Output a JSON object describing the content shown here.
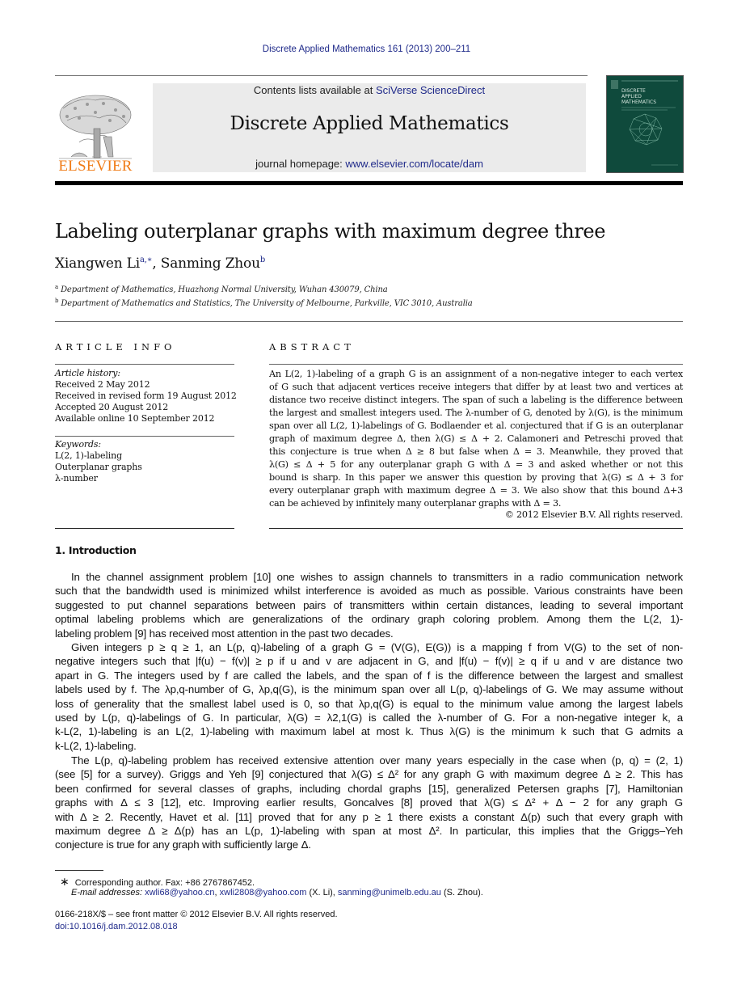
{
  "header": {
    "journal_ref": "Discrete Applied Mathematics 161 (2013) 200–211",
    "contents_prefix": "Contents lists available at ",
    "contents_link": "SciVerse ScienceDirect",
    "journal_title": "Discrete Applied Mathematics",
    "homepage_prefix": "journal homepage: ",
    "homepage_link": "www.elsevier.com/locate/dam",
    "publisher_logo_text": "ELSEVIER",
    "cover_title_lines": [
      "DISCRETE",
      "APPLIED",
      "MATHEMATICS"
    ],
    "colors": {
      "link": "#1f2a8a",
      "elsevier_orange": "#f07b16",
      "cover_green": "#0f4a3c",
      "banner_gray": "#ebebeb"
    }
  },
  "article": {
    "title": "Labeling outerplanar graphs with maximum degree three",
    "authors": [
      {
        "name": "Xiangwen Li",
        "marks": "a,∗"
      },
      {
        "name": "Sanming Zhou",
        "marks": "b"
      }
    ],
    "author_separator": ", ",
    "affiliations": [
      {
        "mark": "a",
        "text": "Department of Mathematics, Huazhong Normal University, Wuhan 430079, China"
      },
      {
        "mark": "b",
        "text": "Department of Mathematics and Statistics, The University of Melbourne, Parkville, VIC 3010, Australia"
      }
    ]
  },
  "article_info": {
    "heading": "ARTICLE INFO",
    "history_label": "Article history:",
    "history": [
      "Received 2 May 2012",
      "Received in revised form 19 August 2012",
      "Accepted 20 August 2012",
      "Available online 10 September 2012"
    ],
    "keywords_label": "Keywords:",
    "keywords": [
      "L(2, 1)-labeling",
      "Outerplanar graphs",
      "λ-number"
    ]
  },
  "abstract": {
    "heading": "ABSTRACT",
    "lines": [
      "An L(2, 1)-labeling of a graph G is an assignment of a non-negative integer to each vertex",
      "of G such that adjacent vertices receive integers that differ by at least two and vertices at",
      "distance two receive distinct integers. The span of such a labeling is the difference between",
      "the largest and smallest integers used. The λ-number of G, denoted by λ(G), is the minimum",
      "span over all L(2, 1)-labelings of G. Bodlaender et al. conjectured that if G is an outerplanar",
      "graph of maximum degree Δ, then λ(G) ≤ Δ + 2. Calamoneri and Petreschi proved that",
      "this conjecture is true when Δ ≥ 8 but false when Δ = 3. Meanwhile, they proved that",
      "λ(G) ≤ Δ + 5 for any outerplanar graph G with Δ = 3 and asked whether or not this",
      "bound is sharp. In this paper we answer this question by proving that λ(G) ≤ Δ + 3 for",
      "every outerplanar graph with maximum degree Δ = 3. We also show that this bound Δ+3",
      "can be achieved by infinitely many outerplanar graphs with Δ = 3."
    ],
    "copyright": "© 2012 Elsevier B.V. All rights reserved."
  },
  "introduction": {
    "heading": "1.  Introduction",
    "paragraphs": [
      [
        "In the channel assignment problem [10] one wishes to assign channels to transmitters in a radio communication network",
        "such that the bandwidth used is minimized whilst interference is avoided as much as possible. Various constraints have been",
        "suggested to put channel separations between pairs of transmitters within certain distances, leading to several important",
        "optimal labeling problems which are generalizations of the ordinary graph coloring problem. Among them the L(2, 1)-",
        "labeling problem [9] has received most attention in the past two decades."
      ],
      [
        "Given integers p ≥ q ≥ 1, an L(p, q)-labeling of a graph G = (V(G), E(G)) is a mapping f from V(G) to the set of non-",
        "negative integers such that |f(u) − f(v)| ≥ p if u and v are adjacent in G, and |f(u) − f(v)| ≥ q if u and v are distance two",
        "apart in G. The integers used by f are called the labels, and the span of f is the difference between the largest and smallest",
        "labels used by f. The λp,q-number of G, λp,q(G), is the minimum span over all L(p, q)-labelings of G. We may assume without",
        "loss of generality that the smallest label used is 0, so that λp,q(G) is equal to the minimum value among the largest labels",
        "used by L(p, q)-labelings of G. In particular, λ(G) = λ2,1(G) is called the λ-number of G. For a non-negative integer k, a",
        "k-L(2, 1)-labeling is an L(2, 1)-labeling with maximum label at most k. Thus λ(G) is the minimum k such that G admits a",
        "k-L(2, 1)-labeling."
      ],
      [
        "The L(p, q)-labeling problem has received extensive attention over many years especially in the case when (p, q) = (2, 1)",
        "(see [5] for a survey). Griggs and Yeh [9] conjectured that λ(G) ≤ Δ² for any graph G with maximum degree Δ ≥ 2. This has",
        "been confirmed for several classes of graphs, including chordal graphs [15], generalized Petersen graphs [7], Hamiltonian",
        "graphs with Δ ≤ 3 [12], etc. Improving earlier results, Goncalves [8] proved that λ(G) ≤ Δ² + Δ − 2 for any graph G",
        "with Δ ≥ 2. Recently, Havet et al. [11] proved that for any p ≥ 1 there exists a constant Δ(p) such that every graph with",
        "maximum degree Δ ≥ Δ(p) has an L(p, 1)-labeling with span at most Δ². In particular, this implies that the Griggs–Yeh",
        "conjecture is true for any graph with sufficiently large Δ."
      ]
    ]
  },
  "footnotes": {
    "corresponding_mark": "∗",
    "corresponding": "Corresponding author. Fax: +86 2767867452.",
    "email_label": "E-mail addresses:",
    "emails": [
      {
        "address": "xwli68@yahoo.cn",
        "suffix": ", "
      },
      {
        "address": "xwli2808@yahoo.com",
        "suffix": " (X. Li), "
      },
      {
        "address": "sanming@unimelb.edu.au",
        "suffix": " (S. Zhou)."
      }
    ],
    "issn_line": "0166-218X/$ – see front matter © 2012 Elsevier B.V. All rights reserved.",
    "doi": "doi:10.1016/j.dam.2012.08.018"
  }
}
